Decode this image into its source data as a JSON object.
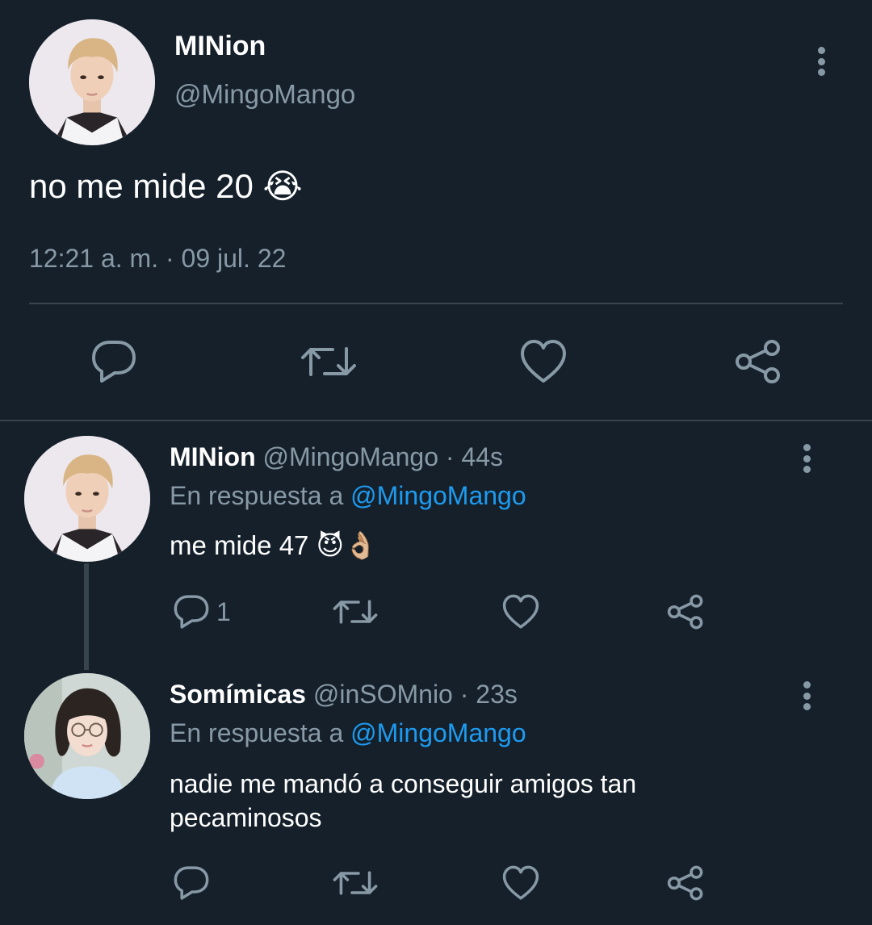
{
  "main_tweet": {
    "display_name": "MINion",
    "handle": "@MingoMango",
    "text": "no me mide 20 😭",
    "timestamp": "12:21 a. m. · 09 jul. 22",
    "avatar_icon": "avatar-blond-man",
    "actions": [
      "reply-icon",
      "retweet-icon",
      "like-icon",
      "share-icon"
    ]
  },
  "replies": [
    {
      "display_name": "MINion",
      "handle": "@MingoMango",
      "age": "· 44s",
      "reply_prefix": "En respuesta a",
      "reply_to": "@MingoMango",
      "text": "me mide 47 😈👌🏼",
      "reply_count": "1",
      "avatar_icon": "avatar-blond-man"
    },
    {
      "display_name": "Somímicas",
      "handle": "@inSOMnio",
      "age": "· 23s",
      "reply_prefix": "En respuesta a",
      "reply_to": "@MingoMango",
      "text_line1": "nadie me mandó a conseguir amigos tan",
      "text_line2": "pecaminosos",
      "avatar_icon": "avatar-woman-glasses"
    }
  ],
  "colors": {
    "background": "#15202b",
    "text": "#ffffff",
    "muted": "#8899a6",
    "link": "#1d9bf0",
    "divider": "#38444d"
  }
}
